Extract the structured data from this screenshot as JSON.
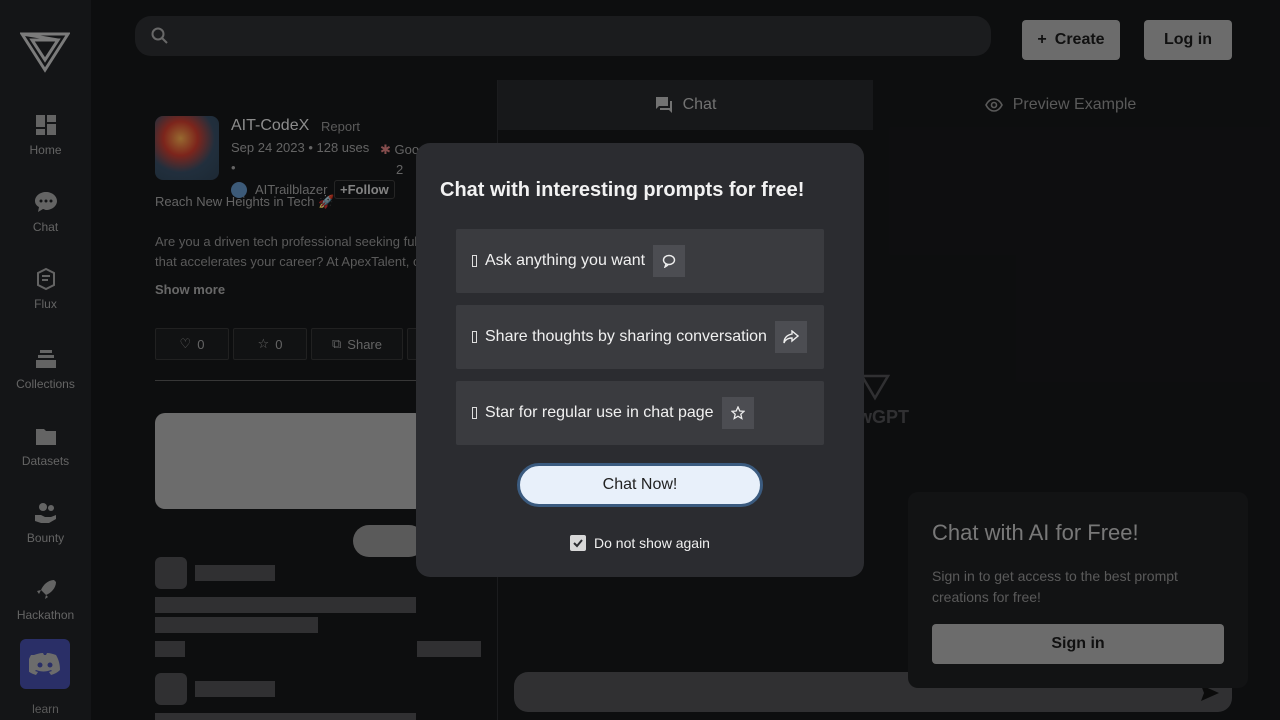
{
  "sidebar": {
    "items": [
      {
        "label": "Home",
        "icon": "dashboard-icon"
      },
      {
        "label": "Chat",
        "icon": "chat-bubble-icon"
      },
      {
        "label": "Flux",
        "icon": "flux-icon"
      },
      {
        "label": "Collections",
        "icon": "stack-icon"
      },
      {
        "label": "Datasets",
        "icon": "folder-icon"
      },
      {
        "label": "Bounty",
        "icon": "hand-coins-icon"
      },
      {
        "label": "Hackathon",
        "icon": "rocket-icon"
      }
    ],
    "learn": "learn"
  },
  "header": {
    "create_label": "Create",
    "login_label": "Log in"
  },
  "prompt": {
    "title": "AIT-CodeX",
    "report": "Report",
    "meta": "Sep 24 2023 • 128 uses",
    "meta_dot": "•",
    "model_short": "Goo",
    "model_count": "2",
    "author": "AITrailblazer",
    "follow": "+Follow",
    "tagline": "Reach New Heights in Tech 🚀",
    "desc_line1": "Are you a driven tech professional seeking fulf",
    "desc_line2": "that accelerates your career? At ApexTalent, o",
    "show_more": "Show more",
    "likes": "0",
    "stars": "0",
    "share": "Share"
  },
  "tabs": {
    "chat": "Chat",
    "preview": "Preview Example"
  },
  "watermark": "wGPT",
  "signin_card": {
    "title": "Chat with AI for Free!",
    "text": "Sign in to get access to the best prompt creations for free!",
    "button": "Sign in"
  },
  "modal": {
    "title": "Chat with interesting prompts for free!",
    "features": [
      "Ask anything you want",
      "Share thoughts by sharing conversation",
      "Star for regular use in chat page"
    ],
    "cta": "Chat Now!",
    "dont_show": "Do not show again"
  }
}
